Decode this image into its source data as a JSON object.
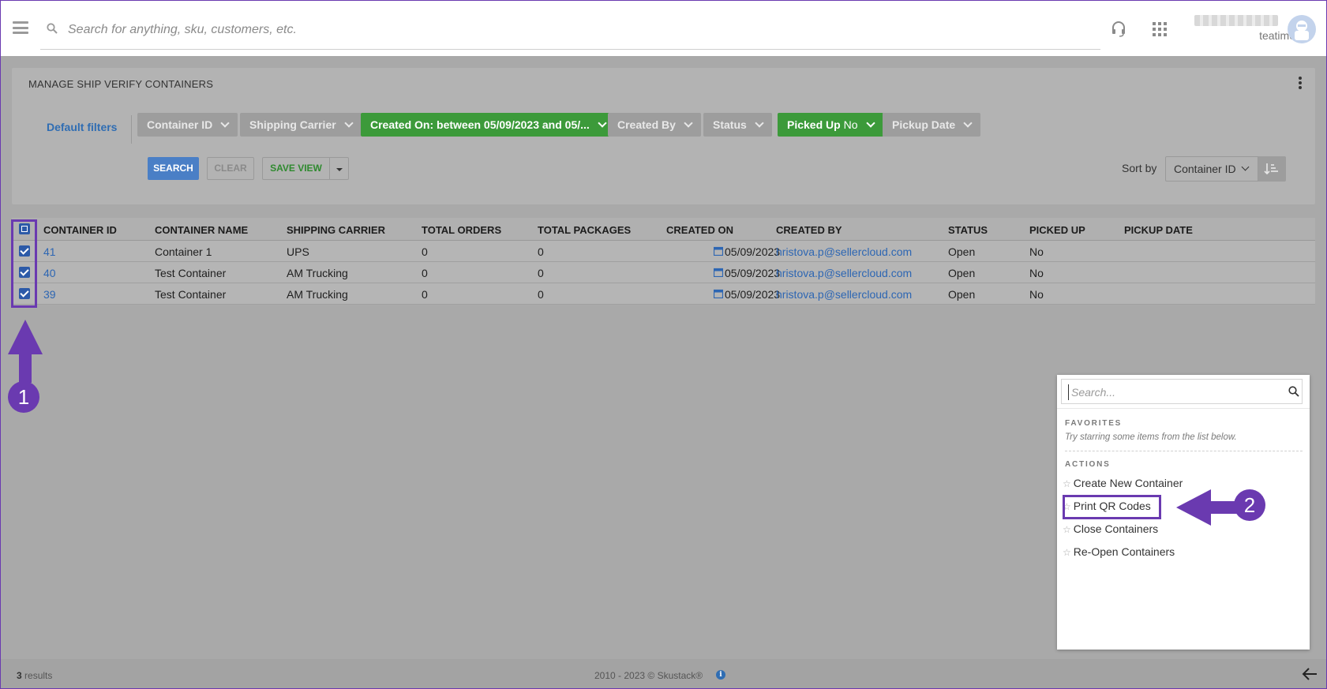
{
  "header": {
    "search_placeholder": "Search for anything, sku, customers, etc.",
    "username": "teatime"
  },
  "panel": {
    "title": "MANAGE SHIP VERIFY CONTAINERS",
    "default_filters_label": "Default filters",
    "filters": [
      {
        "label": "Container ID",
        "active": false
      },
      {
        "label": "Shipping Carrier",
        "active": false
      },
      {
        "label": "Created On:",
        "value": "between 05/09/2023 and 05/...",
        "active": true
      },
      {
        "label": "Created By",
        "active": false
      },
      {
        "label": "Status",
        "active": false
      },
      {
        "label": "Picked Up",
        "value": "No",
        "active": true
      },
      {
        "label": "Pickup Date",
        "active": false
      }
    ],
    "buttons": {
      "search": "SEARCH",
      "clear": "CLEAR",
      "save_view": "SAVE VIEW"
    },
    "sort_by_label": "Sort by",
    "sort_by_value": "Container ID"
  },
  "table": {
    "columns": [
      "CONTAINER ID",
      "CONTAINER NAME",
      "SHIPPING CARRIER",
      "TOTAL ORDERS",
      "TOTAL PACKAGES",
      "CREATED ON",
      "CREATED BY",
      "STATUS",
      "PICKED UP",
      "PICKUP DATE"
    ],
    "rows": [
      {
        "id": "41",
        "name": "Container 1",
        "carrier": "UPS",
        "orders": "0",
        "packages": "0",
        "created_on": "05/09/2023",
        "created_by": "hristova.p@sellercloud.com",
        "status": "Open",
        "picked_up": "No",
        "pickup_date": ""
      },
      {
        "id": "40",
        "name": "Test Container",
        "carrier": "AM Trucking",
        "orders": "0",
        "packages": "0",
        "created_on": "05/09/2023",
        "created_by": "hristova.p@sellercloud.com",
        "status": "Open",
        "picked_up": "No",
        "pickup_date": ""
      },
      {
        "id": "39",
        "name": "Test Container",
        "carrier": "AM Trucking",
        "orders": "0",
        "packages": "0",
        "created_on": "05/09/2023",
        "created_by": "hristova.p@sellercloud.com",
        "status": "Open",
        "picked_up": "No",
        "pickup_date": ""
      }
    ]
  },
  "annotations": {
    "step1": "1",
    "step2": "2",
    "color": "#6a3ab0"
  },
  "actions_menu": {
    "search_placeholder": "Search...",
    "favorites_heading": "FAVORITES",
    "favorites_hint": "Try starring some items from the list below.",
    "actions_heading": "ACTIONS",
    "items": [
      "Create New Container",
      "Print QR Codes",
      "Close Containers",
      "Re-Open Containers"
    ]
  },
  "footer": {
    "results_count": "3",
    "results_label": " results",
    "copyright": "2010 - 2023 © Skustack®"
  },
  "colors": {
    "accent_blue": "#2f6db3",
    "active_filter_green": "#3c9a3a",
    "checkbox_blue": "#2c5aa8"
  }
}
